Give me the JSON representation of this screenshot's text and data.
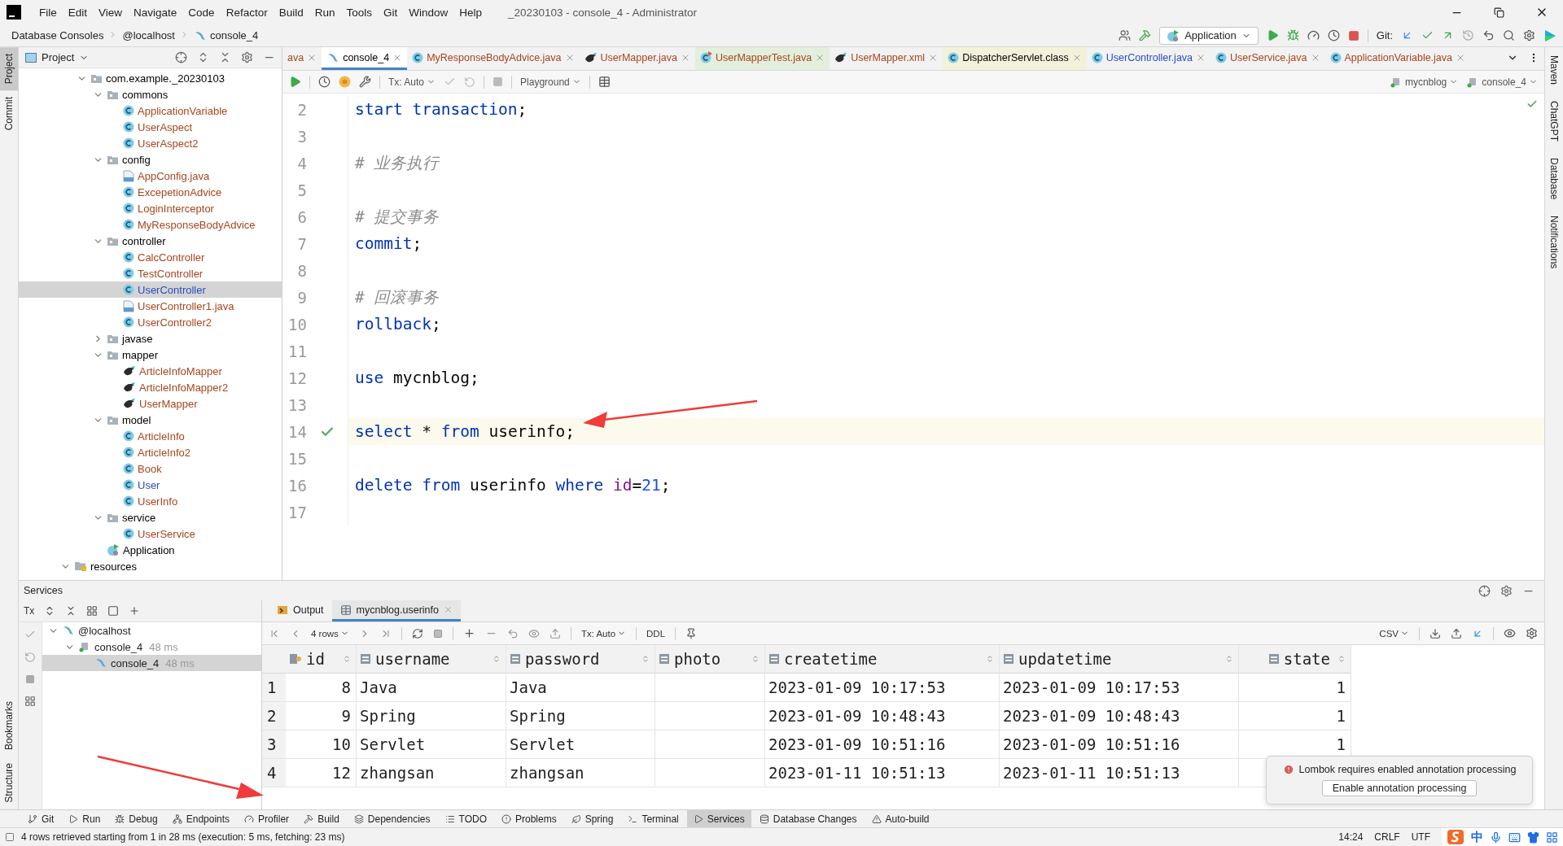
{
  "title_bar": {
    "menu": [
      "File",
      "Edit",
      "View",
      "Navigate",
      "Code",
      "Refactor",
      "Build",
      "Run",
      "Tools",
      "Git",
      "Window",
      "Help"
    ],
    "title": "_20230103 - console_4 - Administrator"
  },
  "breadcrumb": [
    "Database Consoles",
    "@localhost",
    "console_4"
  ],
  "run_toolbar": {
    "configuration": "Application",
    "git_label": "Git:"
  },
  "left_strip": [
    {
      "label": "Project",
      "selected": true
    },
    {
      "label": "Commit",
      "selected": false
    }
  ],
  "left_strip_bottom": [
    "Bookmarks",
    "Structure"
  ],
  "right_strip": [
    "Maven",
    "ChatGPT",
    "Database",
    "Notifications"
  ],
  "project": {
    "title": "Project",
    "items": [
      {
        "label": "com.example._20230103",
        "kind": "package",
        "color": "#000000",
        "expanded": true,
        "selected": false,
        "children": [
          {
            "label": "commons",
            "kind": "package",
            "color": "#000000",
            "expanded": true,
            "selected": false,
            "children": [
              {
                "label": "ApplicationVariable",
                "kind": "class",
                "color": "#a6451e",
                "selected": false
              },
              {
                "label": "UserAspect",
                "kind": "class",
                "color": "#a6451e",
                "selected": false
              },
              {
                "label": "UserAspect2",
                "kind": "class",
                "color": "#a6451e",
                "selected": false
              }
            ]
          },
          {
            "label": "config",
            "kind": "package",
            "color": "#000000",
            "expanded": true,
            "selected": false,
            "children": [
              {
                "label": "AppConfig.java",
                "kind": "java-file",
                "color": "#a6451e",
                "selected": false
              },
              {
                "label": "ExcepetionAdvice",
                "kind": "class",
                "color": "#a6451e",
                "selected": false
              },
              {
                "label": "LoginInterceptor",
                "kind": "class",
                "color": "#a6451e",
                "selected": false
              },
              {
                "label": "MyResponseBodyAdvice",
                "kind": "class",
                "color": "#a6451e",
                "selected": false
              }
            ]
          },
          {
            "label": "controller",
            "kind": "package",
            "color": "#000000",
            "expanded": true,
            "selected": false,
            "children": [
              {
                "label": "CalcController",
                "kind": "class",
                "color": "#a6451e",
                "selected": false
              },
              {
                "label": "TestController",
                "kind": "class",
                "color": "#a6451e",
                "selected": false
              },
              {
                "label": "UserController",
                "kind": "class",
                "color": "#2b4cbf",
                "selected": true
              },
              {
                "label": "UserController1.java",
                "kind": "java-file",
                "color": "#a6451e",
                "selected": false
              },
              {
                "label": "UserController2",
                "kind": "class",
                "color": "#a6451e",
                "selected": false
              }
            ]
          },
          {
            "label": "javase",
            "kind": "package",
            "color": "#000000",
            "expanded": false,
            "selected": false
          },
          {
            "label": "mapper",
            "kind": "package",
            "color": "#000000",
            "expanded": true,
            "selected": false,
            "children": [
              {
                "label": "ArticleInfoMapper",
                "kind": "mybatis",
                "color": "#a6451e",
                "selected": false
              },
              {
                "label": "ArticleInfoMapper2",
                "kind": "mybatis",
                "color": "#a6451e",
                "selected": false
              },
              {
                "label": "UserMapper",
                "kind": "mybatis",
                "color": "#a6451e",
                "selected": false
              }
            ]
          },
          {
            "label": "model",
            "kind": "package",
            "color": "#000000",
            "expanded": true,
            "selected": false,
            "children": [
              {
                "label": "ArticleInfo",
                "kind": "class",
                "color": "#a6451e",
                "selected": false
              },
              {
                "label": "ArticleInfo2",
                "kind": "class",
                "color": "#a6451e",
                "selected": false
              },
              {
                "label": "Book",
                "kind": "class",
                "color": "#a6451e",
                "selected": false
              },
              {
                "label": "User",
                "kind": "class",
                "color": "#2b4cbf",
                "selected": false
              },
              {
                "label": "UserInfo",
                "kind": "class",
                "color": "#a6451e",
                "selected": false
              }
            ]
          },
          {
            "label": "service",
            "kind": "package",
            "color": "#000000",
            "expanded": true,
            "selected": false,
            "children": [
              {
                "label": "UserService",
                "kind": "class",
                "color": "#a6451e",
                "selected": false
              }
            ]
          },
          {
            "label": "Application",
            "kind": "app",
            "color": "#000000",
            "selected": false
          }
        ]
      }
    ],
    "outer_items": [
      {
        "label": "resources",
        "kind": "resources",
        "color": "#000000",
        "expanded": true,
        "selected": false
      }
    ]
  },
  "editor": {
    "tabs": [
      {
        "label": "ava",
        "kind": "none",
        "test": false,
        "library": false,
        "color": "#a6451e",
        "selected": false
      },
      {
        "label": "console_4",
        "kind": "console",
        "test": false,
        "library": false,
        "color": "#000000",
        "selected": true
      },
      {
        "label": "MyResponseBodyAdvice.java",
        "kind": "class",
        "test": false,
        "library": false,
        "color": "#a6451e",
        "selected": false
      },
      {
        "label": "UserMapper.java",
        "kind": "mybatis",
        "test": false,
        "library": false,
        "color": "#a6451e",
        "selected": false
      },
      {
        "label": "UserMapperTest.java",
        "kind": "test-class",
        "test": true,
        "library": false,
        "color": "#a6451e",
        "selected": false
      },
      {
        "label": "UserMapper.xml",
        "kind": "mybatis",
        "test": false,
        "library": false,
        "color": "#a6451e",
        "selected": false
      },
      {
        "label": "DispatcherServlet.class",
        "kind": "class",
        "test": false,
        "library": true,
        "color": "#000000",
        "selected": false
      },
      {
        "label": "UserController.java",
        "kind": "class",
        "test": false,
        "library": false,
        "color": "#2b4cbf",
        "selected": false
      },
      {
        "label": "UserService.java",
        "kind": "class",
        "test": false,
        "library": false,
        "color": "#a6451e",
        "selected": false
      },
      {
        "label": "ApplicationVariable.java",
        "kind": "class",
        "test": false,
        "library": false,
        "color": "#a6451e",
        "selected": false
      }
    ],
    "toolbar": {
      "tx": "Tx: Auto",
      "mode": "Playground",
      "schema": "mycnblog",
      "session": "console_4"
    },
    "lines": [
      {
        "number": "2",
        "current": false,
        "executed": false,
        "tokens": [
          {
            "text": "start transaction",
            "kind": "keyword"
          },
          {
            "text": ";",
            "kind": "plain"
          }
        ]
      },
      {
        "number": "3",
        "current": false,
        "executed": false
      },
      {
        "number": "4",
        "current": false,
        "executed": false,
        "tokens": [
          {
            "text": "# 业务执行",
            "kind": "comment"
          }
        ]
      },
      {
        "number": "5",
        "current": false,
        "executed": false
      },
      {
        "number": "6",
        "current": false,
        "executed": false,
        "tokens": [
          {
            "text": "# 提交事务",
            "kind": "comment"
          }
        ]
      },
      {
        "number": "7",
        "current": false,
        "executed": false,
        "tokens": [
          {
            "text": "commit",
            "kind": "keyword"
          },
          {
            "text": ";",
            "kind": "plain"
          }
        ]
      },
      {
        "number": "8",
        "current": false,
        "executed": false
      },
      {
        "number": "9",
        "current": false,
        "executed": false,
        "tokens": [
          {
            "text": "# 回滚事务",
            "kind": "comment"
          }
        ]
      },
      {
        "number": "10",
        "current": false,
        "executed": false,
        "tokens": [
          {
            "text": "rollback",
            "kind": "keyword"
          },
          {
            "text": ";",
            "kind": "plain"
          }
        ]
      },
      {
        "number": "11",
        "current": false,
        "executed": false
      },
      {
        "number": "12",
        "current": false,
        "executed": false,
        "tokens": [
          {
            "text": "use",
            "kind": "keyword"
          },
          {
            "text": " mycnblog;",
            "kind": "plain"
          }
        ]
      },
      {
        "number": "13",
        "current": false,
        "executed": false
      },
      {
        "number": "14",
        "current": true,
        "executed": true,
        "tokens": [
          {
            "text": "select",
            "kind": "keyword"
          },
          {
            "text": " * ",
            "kind": "plain"
          },
          {
            "text": "from",
            "kind": "keyword"
          },
          {
            "text": " userinfo;",
            "kind": "plain"
          }
        ]
      },
      {
        "number": "15",
        "current": false,
        "executed": false
      },
      {
        "number": "16",
        "current": false,
        "executed": false,
        "tokens": [
          {
            "text": "delete",
            "kind": "keyword"
          },
          {
            "text": " from",
            "kind": "keyword"
          },
          {
            "text": " userinfo ",
            "kind": "plain"
          },
          {
            "text": "where",
            "kind": "keyword"
          },
          {
            "text": " id",
            "kind": "field"
          },
          {
            "text": "=",
            "kind": "plain"
          },
          {
            "text": "21",
            "kind": "number"
          },
          {
            "text": ";",
            "kind": "plain"
          }
        ]
      },
      {
        "number": "17",
        "current": false,
        "executed": false
      }
    ]
  },
  "services": {
    "title": "Services",
    "toolbar_label": "Tx",
    "tree": [
      {
        "label": "@localhost",
        "kind": "server",
        "expanded": true,
        "selected": false,
        "children": [
          {
            "label": "console_4",
            "time": "48 ms",
            "kind": "session",
            "expanded": true,
            "selected": false,
            "children": [
              {
                "label": "console_4",
                "time": "48 ms",
                "kind": "console",
                "selected": true
              }
            ]
          }
        ]
      }
    ],
    "tabs": [
      {
        "label": "Output",
        "kind": "output",
        "selected": false,
        "closable": false
      },
      {
        "label": "mycnblog.userinfo",
        "kind": "table",
        "selected": true,
        "closable": true
      }
    ],
    "result_toolbar": {
      "rows": "4 rows",
      "tx": "Tx: Auto",
      "ddl": "DDL",
      "format": "CSV"
    },
    "table": {
      "columns": [
        {
          "label": "id",
          "kind": "key"
        },
        {
          "label": "username",
          "kind": "column"
        },
        {
          "label": "password",
          "kind": "column"
        },
        {
          "label": "photo",
          "kind": "column"
        },
        {
          "label": "createtime",
          "kind": "column"
        },
        {
          "label": "updatetime",
          "kind": "column"
        },
        {
          "label": "state",
          "kind": "column"
        }
      ],
      "rows": [
        {
          "number": "1",
          "cells": [
            "8",
            "Java",
            "Java",
            null,
            "2023-01-09 10:17:53",
            "2023-01-09 10:17:53",
            "1"
          ]
        },
        {
          "number": "2",
          "cells": [
            "9",
            "Spring",
            "Spring",
            null,
            "2023-01-09 10:48:43",
            "2023-01-09 10:48:43",
            "1"
          ]
        },
        {
          "number": "3",
          "cells": [
            "10",
            "Servlet",
            "Servlet",
            null,
            "2023-01-09 10:51:16",
            "2023-01-09 10:51:16",
            "1"
          ]
        },
        {
          "number": "4",
          "cells": [
            "12",
            "zhangsan",
            "zhangsan",
            null,
            "2023-01-11 10:51:13",
            "2023-01-11 10:51:13",
            null
          ]
        }
      ]
    },
    "notification": {
      "error": true,
      "message": "Lombok requires enabled annotation processing",
      "action": "Enable annotation processing"
    }
  },
  "tool_windows": [
    {
      "label": "Git",
      "kind": "git",
      "selected": false
    },
    {
      "label": "Run",
      "kind": "run",
      "selected": false
    },
    {
      "label": "Debug",
      "kind": "debug",
      "selected": false
    },
    {
      "label": "Endpoints",
      "kind": "endpoints",
      "selected": false
    },
    {
      "label": "Profiler",
      "kind": "profiler",
      "selected": false
    },
    {
      "label": "Build",
      "kind": "build",
      "selected": false
    },
    {
      "label": "Dependencies",
      "kind": "dependencies",
      "selected": false
    },
    {
      "label": "TODO",
      "kind": "todo",
      "selected": false
    },
    {
      "label": "Problems",
      "kind": "problems",
      "selected": false
    },
    {
      "label": "Spring",
      "kind": "spring",
      "selected": false
    },
    {
      "label": "Terminal",
      "kind": "terminal",
      "selected": false
    },
    {
      "label": "Services",
      "kind": "services",
      "selected": true
    },
    {
      "label": "Database Changes",
      "kind": "database",
      "selected": false
    },
    {
      "label": "Auto-build",
      "kind": "warning",
      "selected": false
    }
  ],
  "status_bar": {
    "message": "4 rows retrieved starting from 1 in 28 ms (execution: 5 ms, fetching: 23 ms)",
    "position": "14:24",
    "line_separator": "CRLF",
    "encoding": "UTF",
    "ime_mode": "中"
  }
}
